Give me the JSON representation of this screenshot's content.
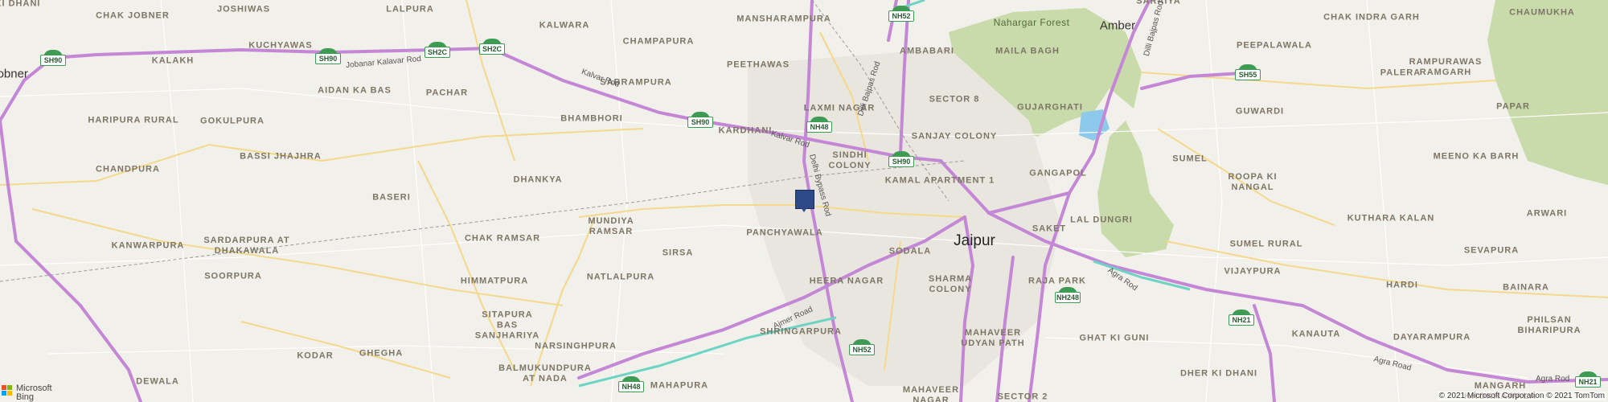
{
  "map": {
    "cities": [
      {
        "name": "Jaipur"
      }
    ],
    "towns": [
      {
        "name": "Amber"
      },
      {
        "name": "Jobner"
      }
    ],
    "forests": [
      {
        "name": "Nahargar Forest"
      }
    ],
    "places": [
      "KI DHANI",
      "CHAK JOBNER",
      "JOSHIWAS",
      "LALPURA",
      "KALWARA",
      "MANSHARAMPURA",
      "SARAIYA",
      "CHAK INDRA GARH",
      "CHAUMUKHA",
      "KUCHYAWAS",
      "KALAKH",
      "CHAMPAPURA",
      "SABRAMPURA",
      "PEETHAWAS",
      "AMBABARI",
      "MAILA BAGH",
      "PEEPALAWALA",
      "PALERA",
      "RAMPURAWAS RAMGARH",
      "AIDAN KA BAS",
      "PACHAR",
      "LAXMI NAGAR",
      "SECTOR 8",
      "GUJARGHATI",
      "GUWARDI",
      "PAPAR",
      "HARIPURA RURAL",
      "GOKULPURA",
      "BHAMBHORI",
      "KARDHANI",
      "SANJAY COLONY",
      "BASSI JHAJHRA",
      "SINDHI COLONY",
      "SUMEL",
      "MEENO KA BARH",
      "CHANDPURA",
      "DHANKYA",
      "BASERI",
      "KAMAL APARTMENT 1",
      "GANGAPOL",
      "ROOPA KI NANGAL",
      "MUNDIYA RAMSAR",
      "LAL DUNGRI",
      "KUTHARA KALAN",
      "ARWARI",
      "KANWARPURA",
      "CHAK RAMSAR",
      "PANCHYAWALA",
      "SODALA",
      "SAKET",
      "SUMEL RURAL",
      "SEVAPURA",
      "SARDARPURA AT DHAKAWALA",
      "SIRSA",
      "SOORPURA",
      "NATLALPURA",
      "HEERA NAGAR",
      "SHARMA COLONY",
      "RAJA PARK",
      "VIJAYPURA",
      "HARDI",
      "BAINARA",
      "HIMMATPURA",
      "SITAPURA BAS SANJHARIYA",
      "PHILSAN BIHARIPURA",
      "SHRINGARPURA",
      "MAHAVEER UDYAN PATH",
      "KANAUTA",
      "DAYARAMPURA",
      "GHAT KI GUNI",
      "NARSINGHPURA",
      "KODAR",
      "GHEGHA",
      "BALMUKUNDPURA AT NADA",
      "DHER KI DHANI",
      "DEWALA",
      "MAHAPURA",
      "MAHAVEER NAGAR",
      "SECTOR 2",
      "MANGARH KHOKHAWALA"
    ],
    "shields": [
      "SH90",
      "SH2C",
      "SH2C",
      "SH90",
      "SH90",
      "NH52",
      "NH48",
      "SH55",
      "NH248",
      "NH21",
      "NH52",
      "NH48",
      "NH21"
    ],
    "road_names": [
      "Jobanar Kalavar Rod",
      "Kalvar Rod",
      "Kalvar Rod",
      "Delhi Bypass Rod",
      "Delhi Bypass Rod",
      "Dilli Bajpas Rod",
      "Ajmer Road",
      "Agra Rod",
      "Agra Road",
      "Agra Rod"
    ],
    "marker_icon": "map-pin-marker",
    "colors": {
      "land": "#f1f0ea",
      "highway": "#c487d6",
      "major_road": "#f4d98c",
      "forest": "#c9dbaa",
      "water": "#8cc9ea",
      "marker": "#2e4a86",
      "expressway": "#6dd3c3",
      "shield": "#3e9b53"
    }
  },
  "attribution": {
    "brand": [
      "Microsoft",
      "Bing"
    ],
    "copyright": "© 2021 Microsoft Corporation © 2021 TomTom"
  }
}
